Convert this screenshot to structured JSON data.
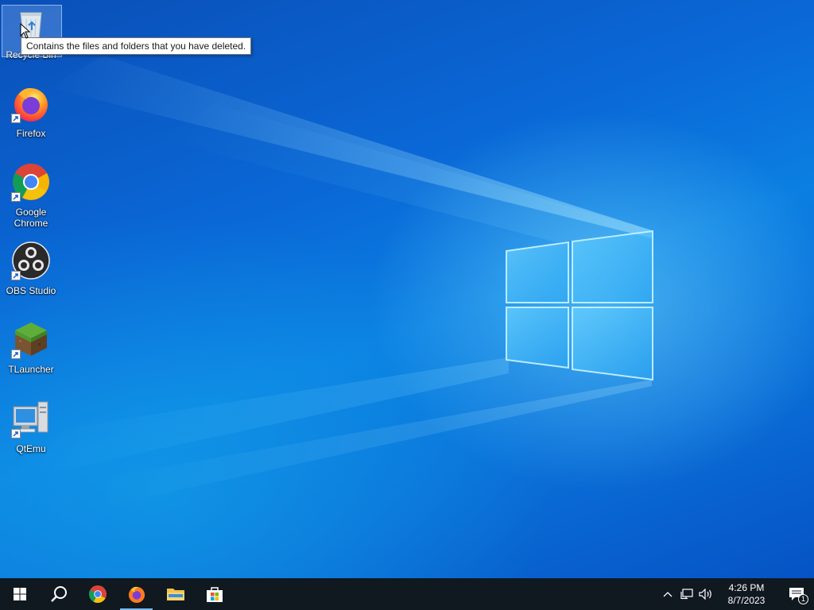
{
  "desktop": {
    "icons": [
      {
        "id": "recycle-bin",
        "label": "Recycle Bin",
        "icon": "recycle-bin-icon",
        "shortcut": false
      },
      {
        "id": "firefox",
        "label": "Firefox",
        "icon": "firefox-icon",
        "shortcut": true
      },
      {
        "id": "chrome",
        "label": "Google Chrome",
        "icon": "chrome-icon",
        "shortcut": true
      },
      {
        "id": "obs",
        "label": "OBS Studio",
        "icon": "obs-studio-icon",
        "shortcut": true
      },
      {
        "id": "tlauncher",
        "label": "TLauncher",
        "icon": "tlauncher-icon",
        "shortcut": true
      },
      {
        "id": "qtemu",
        "label": "QtEmu",
        "icon": "qtemu-icon",
        "shortcut": true
      }
    ],
    "tooltip": "Contains the files and folders that you have deleted."
  },
  "taskbar": {
    "buttons": [
      {
        "name": "start",
        "icon": "windows-logo-icon",
        "active": false
      },
      {
        "name": "search",
        "icon": "search-icon",
        "active": false
      },
      {
        "name": "chrome",
        "icon": "chrome-icon",
        "active": false
      },
      {
        "name": "firefox",
        "icon": "firefox-icon",
        "active": true
      },
      {
        "name": "file-explorer",
        "icon": "folder-icon",
        "active": false
      },
      {
        "name": "microsoft-store",
        "icon": "store-icon",
        "active": false
      }
    ],
    "tray": {
      "icons": [
        "chevron-up-icon",
        "network-icon",
        "volume-icon"
      ],
      "time": "4:26 PM",
      "date": "8/7/2023",
      "notification_count": "1"
    }
  },
  "colors": {
    "taskbar": "#101820",
    "accent": "#76b9ed",
    "wallpaper": "#0a6fd8"
  }
}
